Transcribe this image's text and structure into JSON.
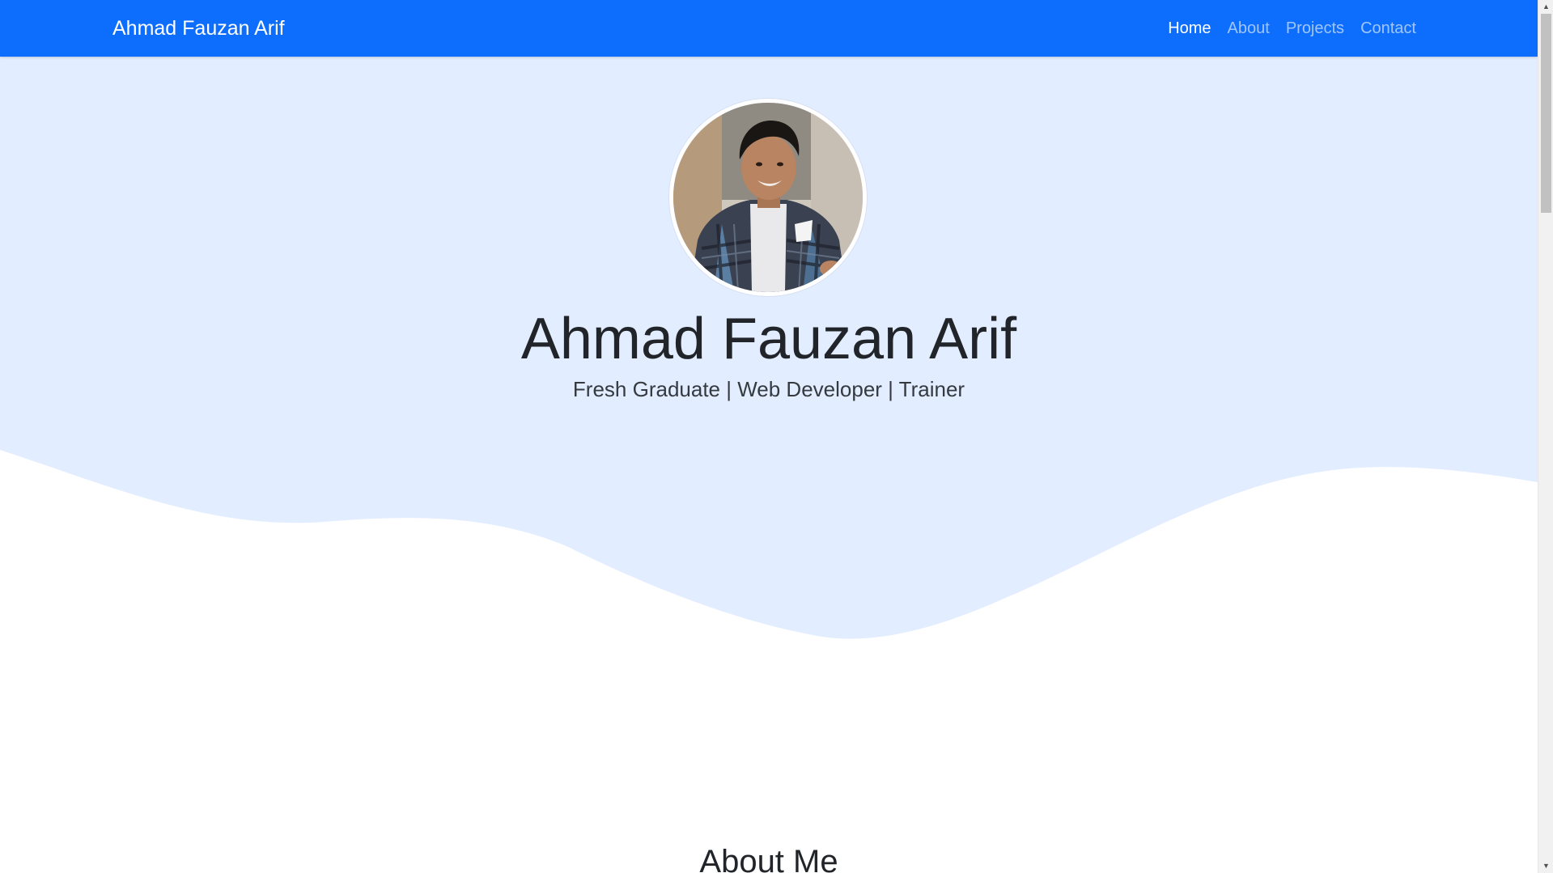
{
  "navbar": {
    "brand": "Ahmad Fauzan Arif",
    "links": [
      {
        "label": "Home",
        "active": true
      },
      {
        "label": "About",
        "active": false
      },
      {
        "label": "Projects",
        "active": false
      },
      {
        "label": "Contact",
        "active": false
      }
    ]
  },
  "hero": {
    "title": "Ahmad Fauzan Arif",
    "subtitle": "Fresh Graduate | Web Developer | Trainer"
  },
  "about": {
    "heading": "About Me"
  },
  "colors": {
    "navbar_bg": "#0d6efd",
    "hero_bg": "#e2edff",
    "text_dark": "#212529"
  },
  "icons": {
    "scroll_up": "scroll-up-arrow-icon",
    "scroll_down": "scroll-down-arrow-icon"
  }
}
